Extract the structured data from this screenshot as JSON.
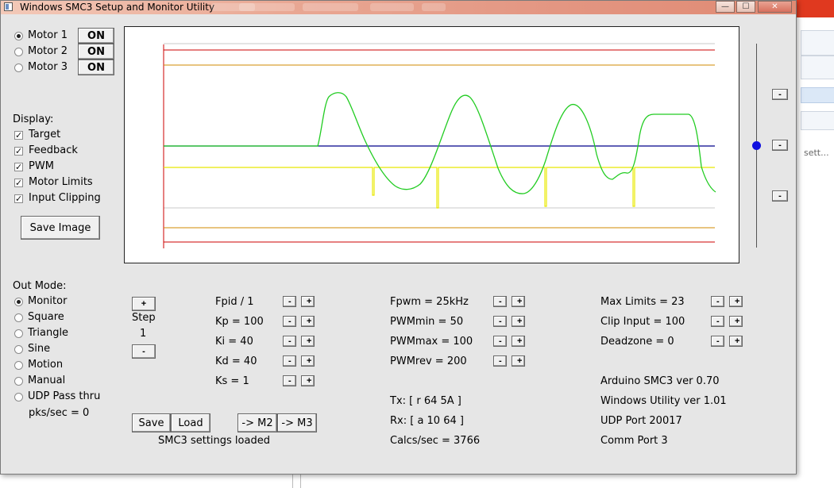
{
  "window": {
    "title": "Windows SMC3 Setup and Monitor Utility",
    "min_glyph": "—",
    "max_glyph": "☐",
    "close_glyph": "✕"
  },
  "motors": [
    {
      "label": "Motor 1",
      "selected": true,
      "toggle": "ON"
    },
    {
      "label": "Motor 2",
      "selected": false,
      "toggle": "ON"
    },
    {
      "label": "Motor 3",
      "selected": false,
      "toggle": "ON"
    }
  ],
  "display": {
    "heading": "Display:",
    "items": [
      {
        "label": "Target",
        "checked": true
      },
      {
        "label": "Feedback",
        "checked": true
      },
      {
        "label": "PWM",
        "checked": true
      },
      {
        "label": "Motor Limits",
        "checked": true
      },
      {
        "label": "Input Clipping",
        "checked": true
      }
    ],
    "save_image": "Save Image"
  },
  "out_mode": {
    "heading": "Out Mode:",
    "options": [
      {
        "label": "Monitor",
        "selected": true
      },
      {
        "label": "Square",
        "selected": false
      },
      {
        "label": "Triangle",
        "selected": false
      },
      {
        "label": "Sine",
        "selected": false
      },
      {
        "label": "Motion",
        "selected": false
      },
      {
        "label": "Manual",
        "selected": false
      },
      {
        "label": "UDP Pass thru",
        "selected": false
      }
    ],
    "pks": "pks/sec = 0"
  },
  "step": {
    "plus": "+",
    "label": "Step",
    "value": "1",
    "minus": "-"
  },
  "params_col1": [
    {
      "label": "Fpid / 1"
    },
    {
      "label": "Kp = 100"
    },
    {
      "label": "Ki = 40"
    },
    {
      "label": "Kd = 40"
    },
    {
      "label": "Ks = 1"
    }
  ],
  "params_col2": [
    {
      "label": "Fpwm = 25kHz"
    },
    {
      "label": "PWMmin = 50"
    },
    {
      "label": "PWMmax = 100"
    },
    {
      "label": "PWMrev = 200"
    }
  ],
  "params_col3": [
    {
      "label": "Max Limits = 23"
    },
    {
      "label": "Clip Input = 100"
    },
    {
      "label": "Deadzone = 0"
    }
  ],
  "spin": {
    "minus": "-",
    "plus": "+"
  },
  "buttons": {
    "save": "Save",
    "load": "Load",
    "to_m2": "-> M2",
    "to_m3": "-> M3"
  },
  "status": {
    "settings": "SMC3 settings loaded",
    "tx": "Tx: [ r 64 5A ]",
    "rx": "Rx: [ a 10 64 ]",
    "calcs": "Calcs/sec = 3766"
  },
  "info": {
    "arduino": "Arduino SMC3 ver 0.70",
    "utility": "Windows Utility ver 1.01",
    "udp": "UDP Port 20017",
    "comm": "Comm Port 3"
  },
  "slider": {
    "buttons": [
      "-",
      "-",
      "-"
    ],
    "level": 0.5
  },
  "colors": {
    "target": "#00008b",
    "feedback": "#22cc22",
    "pwm": "#e8e800",
    "limit_outer": "#cc0000",
    "limit_inner": "#d08a00",
    "grid": "#c8c8c8"
  },
  "background_app": {
    "text": "sett..."
  }
}
